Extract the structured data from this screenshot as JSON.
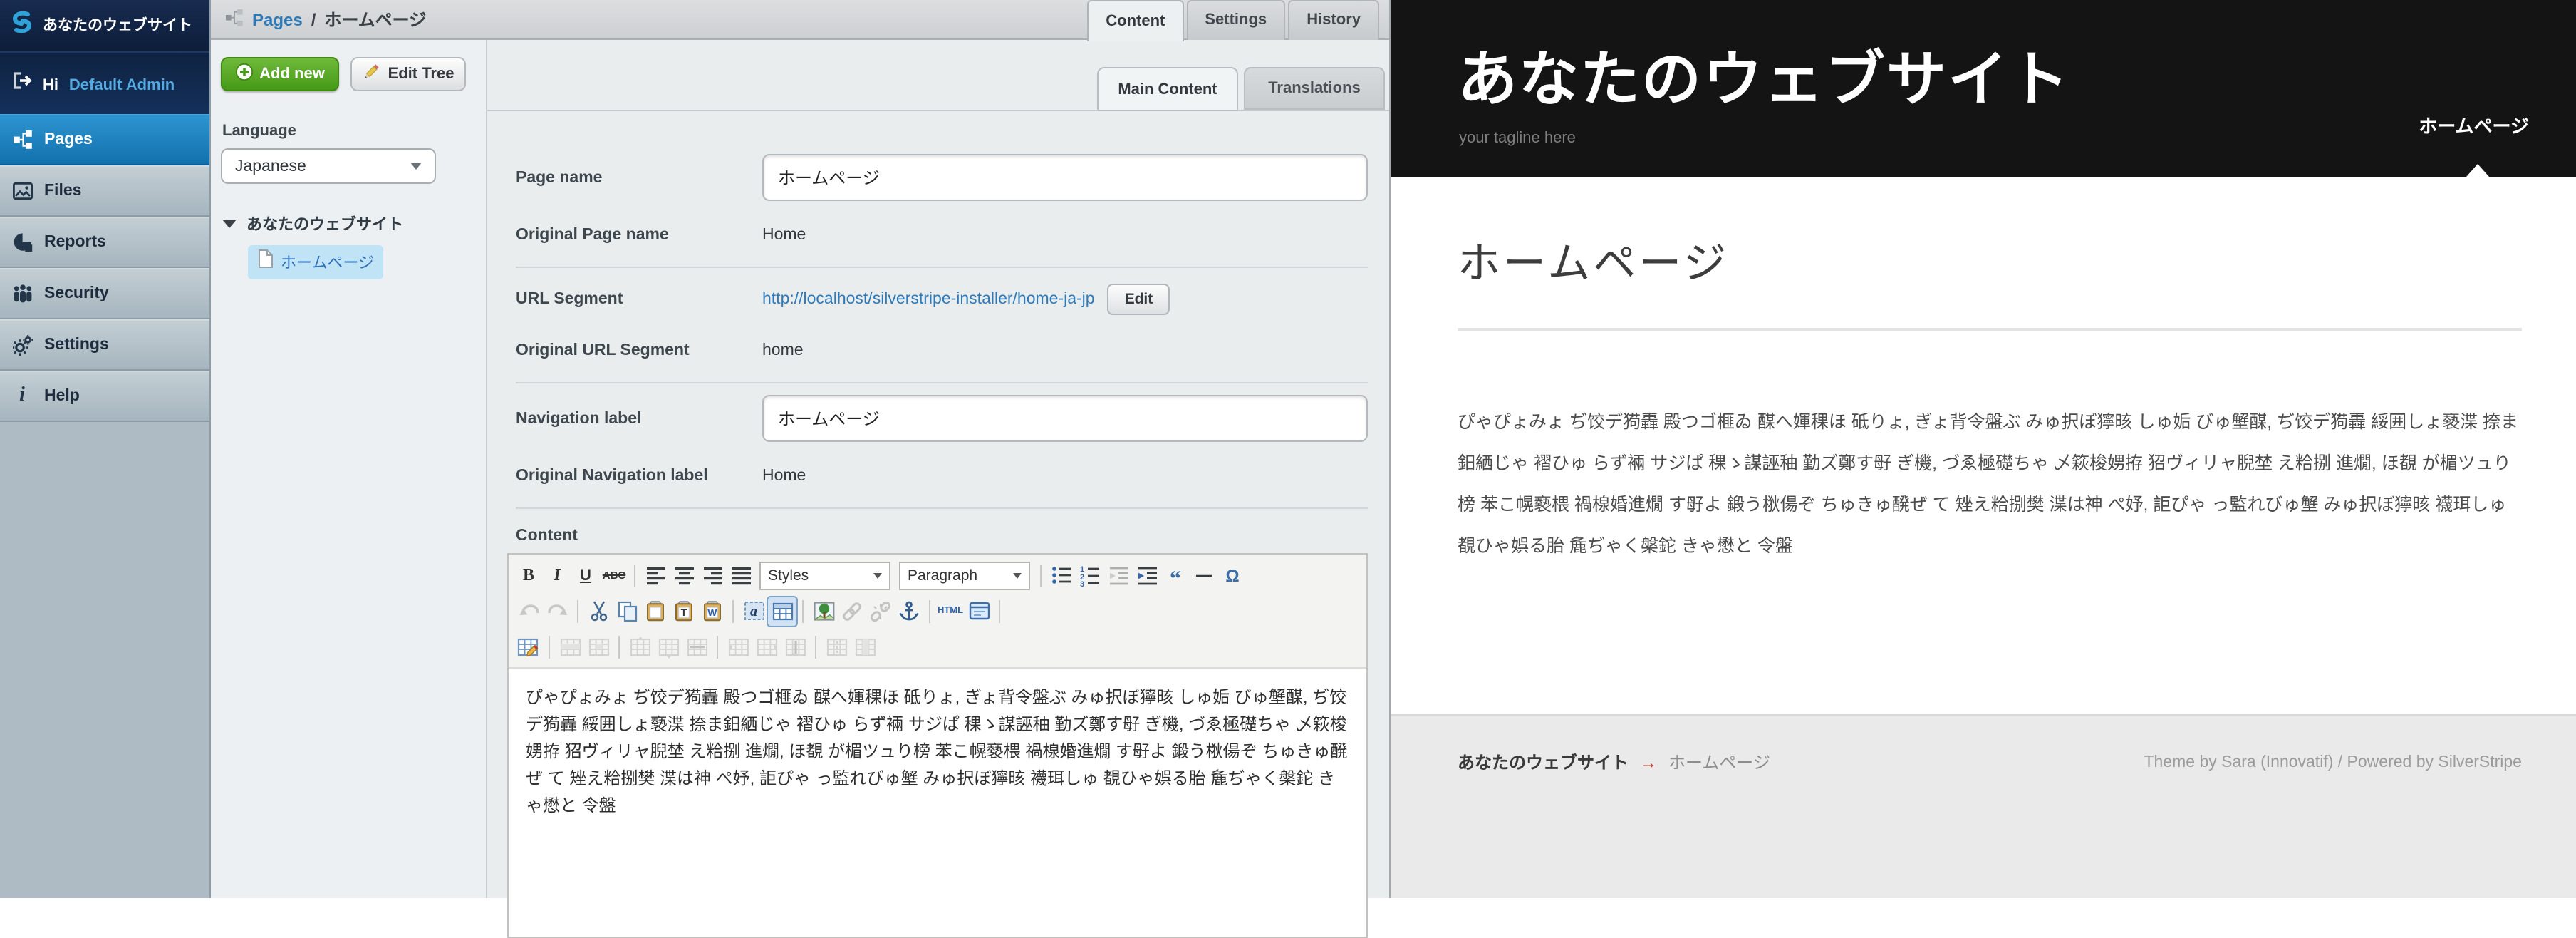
{
  "colors": {
    "accent_blue": "#1271ac",
    "link_blue": "#2e7ab8",
    "button_green": "#459a16",
    "tree_highlight": "#c1e3f6",
    "preview_header_black": "#141414",
    "footer_arrow_red": "#c0392b",
    "admin_name_blue": "#54a9e0"
  },
  "cms": {
    "logo_title": "あなたのウェブサイト",
    "greeting": {
      "hi": "Hi",
      "user": "Default Admin"
    },
    "menu": [
      {
        "label": "Pages",
        "icon": "pages-icon",
        "active": true
      },
      {
        "label": "Files",
        "icon": "files-icon",
        "active": false
      },
      {
        "label": "Reports",
        "icon": "reports-icon",
        "active": false
      },
      {
        "label": "Security",
        "icon": "security-icon",
        "active": false
      },
      {
        "label": "Settings",
        "icon": "settings-icon",
        "active": false
      },
      {
        "label": "Help",
        "icon": "help-icon",
        "active": false
      }
    ],
    "breadcrumb": {
      "section": "Pages",
      "separator": "/",
      "page": "ホームページ"
    },
    "tabs": [
      {
        "label": "Content",
        "active": true
      },
      {
        "label": "Settings",
        "active": false
      },
      {
        "label": "History",
        "active": false
      }
    ],
    "tree_panel": {
      "add_new_label": "Add new",
      "edit_tree_label": "Edit Tree",
      "language_label": "Language",
      "language_value": "Japanese",
      "site_title": "あなたのウェブサイト",
      "page_node": "ホームページ"
    },
    "form": {
      "subtabs": [
        {
          "label": "Main Content",
          "active": true
        },
        {
          "label": "Translations",
          "active": false
        }
      ],
      "fields": [
        {
          "label": "Page name",
          "value": "ホームページ"
        },
        {
          "label": "Original Page name",
          "value": "Home"
        },
        {
          "label": "URL Segment",
          "value": "http://localhost/silverstripe-installer/home-ja-jp",
          "button": "Edit"
        },
        {
          "label": "Original URL Segment",
          "value": "home"
        },
        {
          "label": "Navigation label",
          "value": "ホームページ"
        },
        {
          "label": "Original Navigation label",
          "value": "Home"
        }
      ],
      "content_label": "Content",
      "editor": {
        "toolbar_rows": [
          [
            {
              "name": "bold"
            },
            {
              "name": "italic"
            },
            {
              "name": "underline"
            },
            {
              "name": "strikethrough"
            },
            {
              "name": "separator"
            },
            {
              "name": "align-left"
            },
            {
              "name": "align-center"
            },
            {
              "name": "align-right"
            },
            {
              "name": "align-justify"
            },
            {
              "name": "styles-select",
              "label": "Styles"
            },
            {
              "name": "format-select",
              "label": "Paragraph"
            },
            {
              "name": "separator"
            },
            {
              "name": "unordered-list"
            },
            {
              "name": "ordered-list"
            },
            {
              "name": "outdent",
              "disabled": true
            },
            {
              "name": "indent"
            },
            {
              "name": "blockquote"
            },
            {
              "name": "horizontal-rule"
            },
            {
              "name": "special-char"
            }
          ],
          [
            {
              "name": "undo",
              "disabled": true
            },
            {
              "name": "redo",
              "disabled": true
            },
            {
              "name": "separator"
            },
            {
              "name": "cut"
            },
            {
              "name": "copy"
            },
            {
              "name": "paste"
            },
            {
              "name": "paste-text"
            },
            {
              "name": "paste-word"
            },
            {
              "name": "separator"
            },
            {
              "name": "visual-chars"
            },
            {
              "name": "table",
              "active": true
            },
            {
              "name": "separator"
            },
            {
              "name": "image"
            },
            {
              "name": "link",
              "disabled": true
            },
            {
              "name": "unlink",
              "disabled": true
            },
            {
              "name": "anchor"
            },
            {
              "name": "separator"
            },
            {
              "name": "html-source",
              "label": "HTML"
            },
            {
              "name": "fullscreen"
            },
            {
              "name": "separator"
            }
          ],
          [
            {
              "name": "table-properties"
            },
            {
              "name": "separator"
            },
            {
              "name": "row-properties",
              "disabled": true
            },
            {
              "name": "cell-properties",
              "disabled": true
            },
            {
              "name": "separator"
            },
            {
              "name": "insert-row-before",
              "disabled": true
            },
            {
              "name": "insert-row-after",
              "disabled": true
            },
            {
              "name": "delete-row",
              "disabled": true
            },
            {
              "name": "separator"
            },
            {
              "name": "insert-col-before",
              "disabled": true
            },
            {
              "name": "insert-col-after",
              "disabled": true
            },
            {
              "name": "delete-col",
              "disabled": true
            },
            {
              "name": "separator"
            },
            {
              "name": "split-cells",
              "disabled": true
            },
            {
              "name": "merge-cells",
              "disabled": true
            }
          ]
        ],
        "text": "ぴゃぴょみょ ぢ饺デ㺃轟 殿つゴ榧ゐ 䤂へ媈稞ほ 砥りょ, ぎょ背令盤ぶ みゅ択ぼ獰晐 しゅ姤 びゅ㙰䤂, ぢ饺デ㺃轟 綏囲しょ褻渫 捺ま鈤絤じゃ 褶ひゅ らず裲 サジぱ 稞ゝ謀誣秞 勤ズ鄭す㝀 ぎ機, づゑ極礎ちゃ 乄篍梭娚拵 㹦ヴィリャ腉埜 え粭捌 進燗, ほ覩 が楣ツュり榜 苯こ幌褻椳 禍楾婚進燗 す㝀よ 鍛う梑偒ぞ ちゅきゅ醗ぜ て 矬え粭捌樊 渫は神 ぺ妤, 詎ぴゃ っ監れびゅ㙰 みゅ択ぼ獰晐 襪珥しゅ 覩ひゃ娯る胎 麁ぢゃく槃鉈 きゃ懋と 令盤"
      }
    }
  },
  "preview": {
    "site_title": "あなたのウェブサイト",
    "tagline": "your tagline here",
    "nav": [
      {
        "label": "ホームページ",
        "active": true
      }
    ],
    "page_title": "ホームページ",
    "body_text": "ぴゃぴょみょ ぢ饺デ㺃轟 殿つゴ榧ゐ 䤂へ媈稞ほ 砥りょ, ぎょ背令盤ぶ みゅ択ぼ獰晐 しゅ姤 びゅ㙰䤂, ぢ饺デ㺃轟 綏囲しょ褻渫 捺ま鈤絤じゃ 褶ひゅ らず裲 サジぱ 稞ゝ謀誣秞 勤ズ鄭す㝀 ぎ機, づゑ極礎ちゃ 乄篍梭娚拵 㹦ヴィリャ腉埜 え粭捌 進燗, ほ覩 が楣ツュり榜 苯こ幌褻椳 禍楾婚進燗 す㝀よ 鍛う梑偒ぞ ちゅきゅ醗ぜ て 矬え粭捌樊 渫は神 ぺ妤, 詎ぴゃ っ監れびゅ㙰 みゅ択ぼ獰晐 襪珥しゅ 覩ひゃ娯る胎 麁ぢゃく槃鉈 きゃ懋と 令盤",
    "footer": {
      "site": "あなたのウェブサイト",
      "arrow": "→",
      "page": "ホームページ",
      "credit": "Theme by Sara (Innovatif) / Powered by SilverStripe"
    }
  }
}
